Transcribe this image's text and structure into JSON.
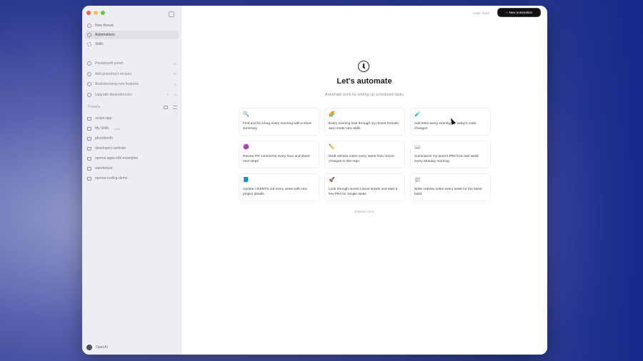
{
  "sidebar": {
    "nav": [
      {
        "label": "New thread",
        "icon": "edit-icon"
      },
      {
        "label": "Automations",
        "icon": "clock-icon",
        "active": true
      },
      {
        "label": "Skills",
        "icon": "skills-icon"
      }
    ],
    "pinned": [
      {
        "label": "Photobooth polish",
        "time": "5h"
      },
      {
        "label": "Add grandma's recipes",
        "time": "5h"
      },
      {
        "label": "Brainstorming new features",
        "time": "7h"
      },
      {
        "label": "Upgrade dependencies",
        "time": "7h",
        "extra": "+"
      }
    ],
    "threads_heading": "Threads",
    "folders": [
      {
        "label": "recipe-app"
      },
      {
        "label": "My Skills",
        "sub": "skills"
      },
      {
        "label": "photobooth"
      },
      {
        "label": "developers-website"
      },
      {
        "label": "openai-apps-sdk-examples"
      },
      {
        "label": "wanderlust"
      },
      {
        "label": "openai-coding-demo"
      }
    ],
    "user": "OpenAI"
  },
  "header": {
    "learn_more": "Learn more",
    "new_automation": "New automation"
  },
  "main": {
    "title": "Let's automate",
    "subtitle": "Automate work by setting up scheduled tasks",
    "explore_more": "Explore more",
    "cards": [
      {
        "emoji": "🔍",
        "text": "Find and fix a bug every morning with a short summary"
      },
      {
        "emoji": "🌈",
        "text": "Every evening look through my recent threads and create new skills"
      },
      {
        "emoji": "🧪",
        "text": "Add tests every evening for today's code changes"
      },
      {
        "emoji": "🟣",
        "text": "Review PR comments every hour and share next steps"
      },
      {
        "emoji": "✏️",
        "text": "Draft release notes every week from recent changes in this repo"
      },
      {
        "emoji": "📖",
        "text": "Summarize my team's PRs from last week every Monday morning"
      },
      {
        "emoji": "📘",
        "text": "Update AGENTS.md every week with new project details"
      },
      {
        "emoji": "🚀",
        "text": "Look through recent Linear tickets and start a few PRs for simple tasks"
      },
      {
        "emoji": "📰",
        "text": "Write release notes every week for the latest build"
      }
    ]
  },
  "colors": {
    "accent_button": "#111111",
    "sidebar_bg": "#eceef3",
    "traffic_red": "#ee5f57",
    "traffic_yellow": "#f6be4f",
    "traffic_green": "#5fc454"
  }
}
